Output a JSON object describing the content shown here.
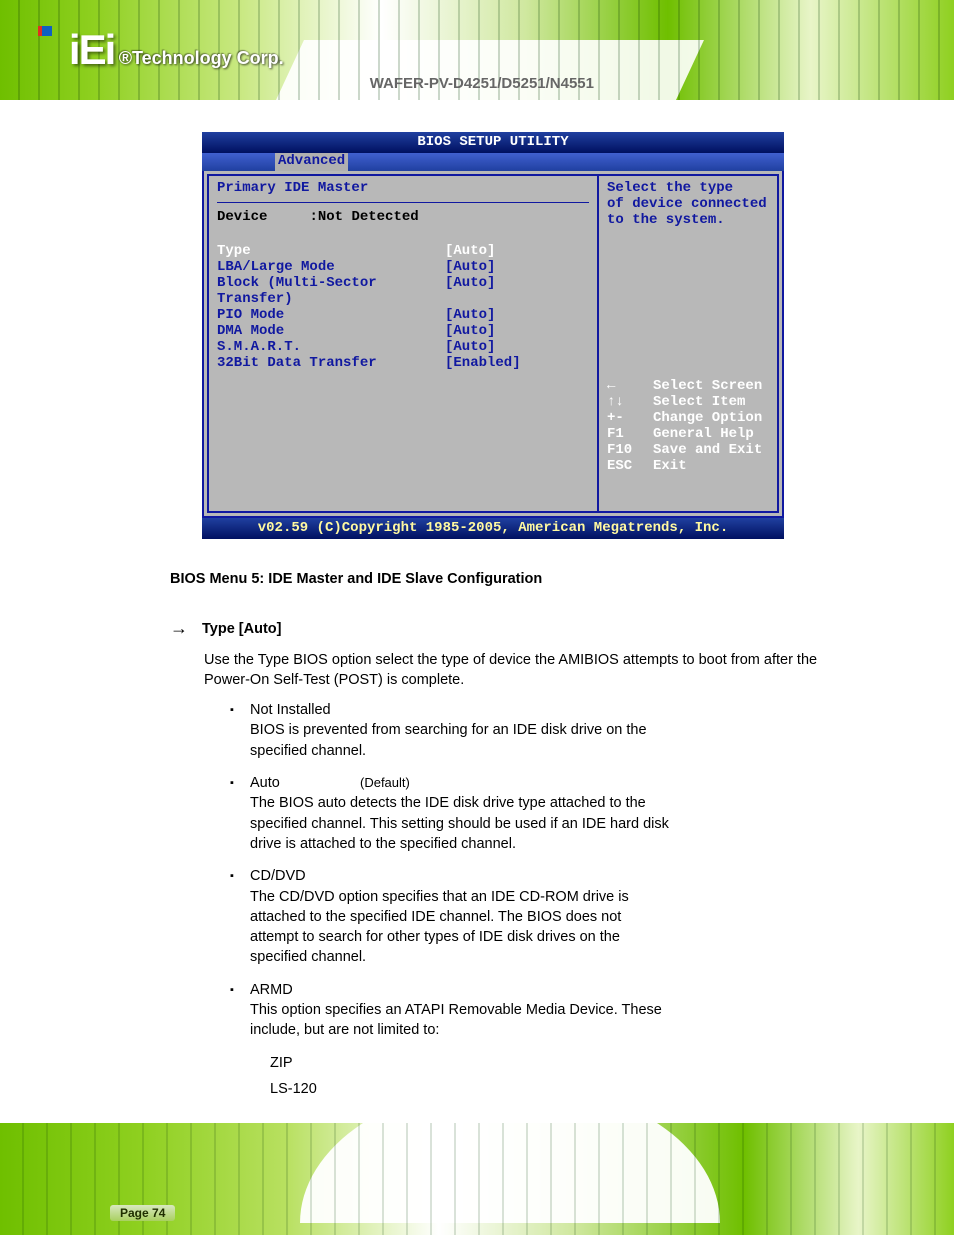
{
  "header": {
    "logo_text": "iEi",
    "logo_sub": "®Technology Corp.",
    "product_code": "WAFER-PV-D4251/D5251/N4551"
  },
  "bios": {
    "title": "BIOS SETUP UTILITY",
    "tab_active": "Advanced",
    "section_title": "Primary IDE Master",
    "device_label": "Device",
    "device_value": ":Not Detected",
    "options": [
      {
        "label": "Type",
        "value": "[Auto]",
        "selected": true
      },
      {
        "label": "LBA/Large Mode",
        "value": "[Auto]",
        "selected": false
      },
      {
        "label": "Block (Multi-Sector Transfer)",
        "value": "[Auto]",
        "selected": false
      },
      {
        "label": "PIO Mode",
        "value": "[Auto]",
        "selected": false
      },
      {
        "label": "DMA Mode",
        "value": "[Auto]",
        "selected": false
      },
      {
        "label": "S.M.A.R.T.",
        "value": "[Auto]",
        "selected": false
      },
      {
        "label": "32Bit Data Transfer",
        "value": "[Enabled]",
        "selected": false
      }
    ],
    "help_text": [
      "Select the type",
      "of device connected",
      "to the system."
    ],
    "nav": [
      {
        "key": "←",
        "desc": "Select Screen"
      },
      {
        "key": "↑↓",
        "desc": "Select Item"
      },
      {
        "key": "+-",
        "desc": "Change Option"
      },
      {
        "key": "F1",
        "desc": "General Help"
      },
      {
        "key": "F10",
        "desc": "Save and Exit"
      },
      {
        "key": "ESC",
        "desc": "Exit"
      }
    ],
    "footer": "v02.59 (C)Copyright 1985-2005, American Megatrends, Inc."
  },
  "doc": {
    "caption": "BIOS Menu 5: IDE Master and IDE Slave Configuration",
    "setting": {
      "name": "Type [Auto]"
    },
    "para1": "Use the Type BIOS option select the type of device the AMIBIOS attempts to boot from after the Power-On Self-Test (POST) is complete.",
    "bullets1": [
      {
        "label": "Not Installed",
        "desc": "BIOS is prevented from searching for an IDE disk drive on the specified channel."
      },
      {
        "label": "Auto",
        "desc": "The BIOS auto detects the IDE disk drive type attached to the specified channel. This setting should be used if an IDE hard disk drive is attached to the specified channel."
      },
      {
        "label": "CD/DVD",
        "desc": "The CD/DVD option specifies that an IDE CD-ROM drive is attached to the specified IDE channel. The BIOS does not attempt to search for other types of IDE disk drives on the specified channel."
      },
      {
        "label": "ARMD",
        "desc": "This option specifies an ATAPI Removable Media Device. These include, but are not limited to:"
      }
    ],
    "sub_items": [
      "ZIP",
      "LS-120"
    ],
    "default_label": "(Default)"
  },
  "footer": {
    "page_label": "Page 74",
    "page_num": "74"
  }
}
